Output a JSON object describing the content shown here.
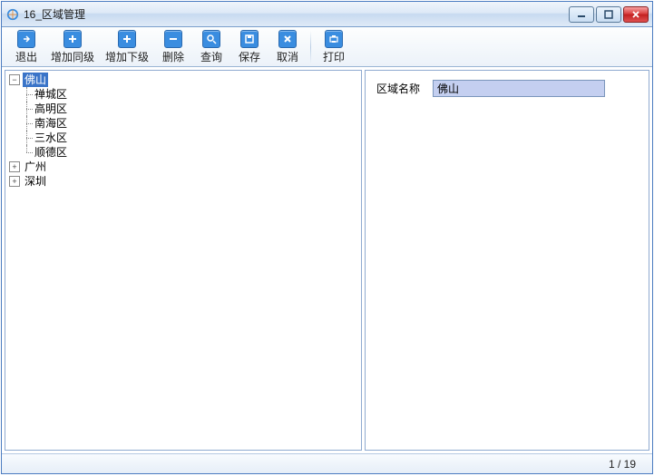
{
  "window": {
    "title": "16_区域管理"
  },
  "toolbar": {
    "exit": "退出",
    "add_sibling": "增加同级",
    "add_child": "增加下级",
    "delete": "删除",
    "query": "查询",
    "save": "保存",
    "cancel": "取消",
    "print": "打印"
  },
  "tree": {
    "nodes": [
      {
        "label": "佛山",
        "expanded": true,
        "selected": true,
        "children": [
          {
            "label": "禅城区"
          },
          {
            "label": "高明区"
          },
          {
            "label": "南海区"
          },
          {
            "label": "三水区"
          },
          {
            "label": "顺德区"
          }
        ]
      },
      {
        "label": "广州",
        "expanded": false
      },
      {
        "label": "深圳",
        "expanded": false
      }
    ]
  },
  "form": {
    "area_name_label": "区域名称",
    "area_name_value": "佛山"
  },
  "status": {
    "pager": "1 / 19"
  }
}
